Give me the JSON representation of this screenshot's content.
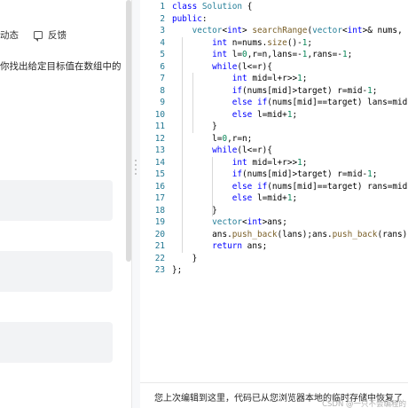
{
  "left_panel": {
    "tabs": {
      "activity": "动态",
      "feedback": "反馈"
    },
    "problem_snippet": "你找出给定目标值在数组中的"
  },
  "editor": {
    "line_numbers": [
      "1",
      "2",
      "3",
      "4",
      "5",
      "6",
      "7",
      "8",
      "9",
      "10",
      "11",
      "12",
      "13",
      "14",
      "15",
      "16",
      "17",
      "18",
      "19",
      "20",
      "21",
      "22",
      "23"
    ],
    "code_lines": [
      "class Solution {",
      "public:",
      "    vector<int> searchRange(vector<int>& nums, int",
      "        int n=nums.size()-1;",
      "        int l=0,r=n,lans=-1,rans=-1;",
      "        while(l<=r){",
      "            int mid=l+r>>1;",
      "            if(nums[mid]>target) r=mid-1;",
      "            else if(nums[mid]==target) lans=mid,r",
      "            else l=mid+1;",
      "        }",
      "        l=0,r=n;",
      "        while(l<=r){",
      "            int mid=l+r>>1;",
      "            if(nums[mid]>target) r=mid-1;",
      "            else if(nums[mid]==target) rans=mid,l",
      "            else l=mid+1;",
      "        }",
      "        vector<int>ans;",
      "        ans.push_back(lans);ans.push_back(rans);",
      "        return ans;",
      "    }",
      "};"
    ]
  },
  "status_bar": {
    "message": "您上次编辑到这里，代码已从您浏览器本地的临时存储中恢复了",
    "watermark": "CSDN @一只不会编程的"
  },
  "colors": {
    "keyword": "#0000ff",
    "type": "#267f99",
    "function": "#795e26",
    "number": "#098658",
    "line_number": "#237893"
  }
}
